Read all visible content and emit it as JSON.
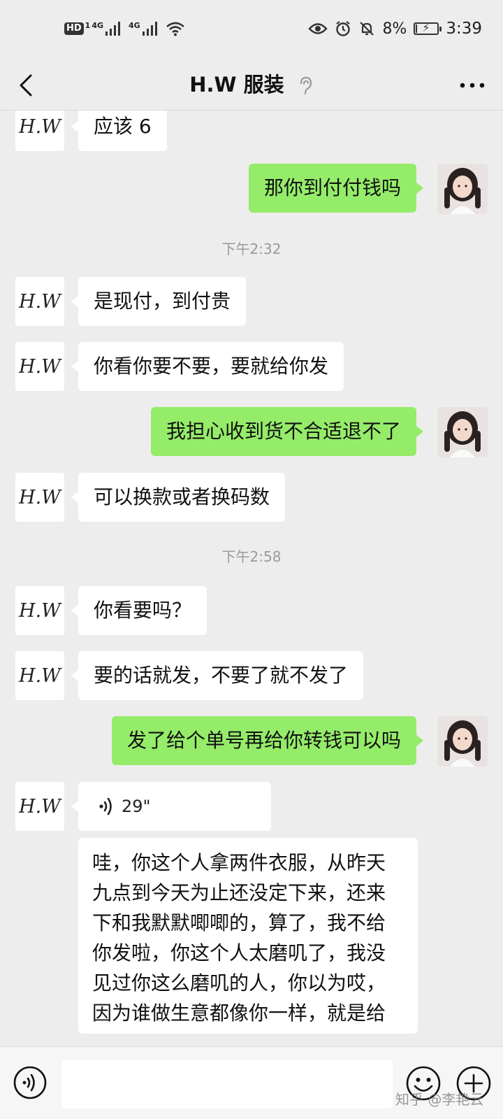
{
  "status_bar": {
    "hd_label": "HD",
    "sim_slot": "1",
    "signal1_label": "4G",
    "signal2_label": "4G",
    "battery_percent": "8%",
    "battery_level": 0.08,
    "time": "3:39"
  },
  "header": {
    "title": "H.W 服装"
  },
  "contact_avatar_text": "H.W",
  "messages": {
    "m0": "应该 6",
    "m1": "那你到付付钱吗",
    "ts1": "下午2:32",
    "m2": "是现付，到付贵",
    "m3": "你看你要不要，要就给你发",
    "m4": "我担心收到货不合适退不了",
    "m5": "可以换款或者换码数",
    "ts2": "下午2:58",
    "m6": "你看要吗？",
    "m7": "要的话就发，不要了就不发了",
    "m8": "发了给个单号再给你转钱可以吗",
    "voice_duration": "29\"",
    "m9": "哇，你这个人拿两件衣服，从昨天九点到今天为止还没定下来，还来下和我默默唧唧的，算了，我不给你发啦，你这个人太磨叽了，我没见过你这么磨叽的人，你以为哎，因为谁做生意都像你一样，就是给"
  },
  "input": {
    "value": ""
  },
  "watermark": "知乎 @李艳云",
  "colors": {
    "background": "#ededed",
    "self_bubble": "#95ec69",
    "other_bubble": "#ffffff"
  }
}
